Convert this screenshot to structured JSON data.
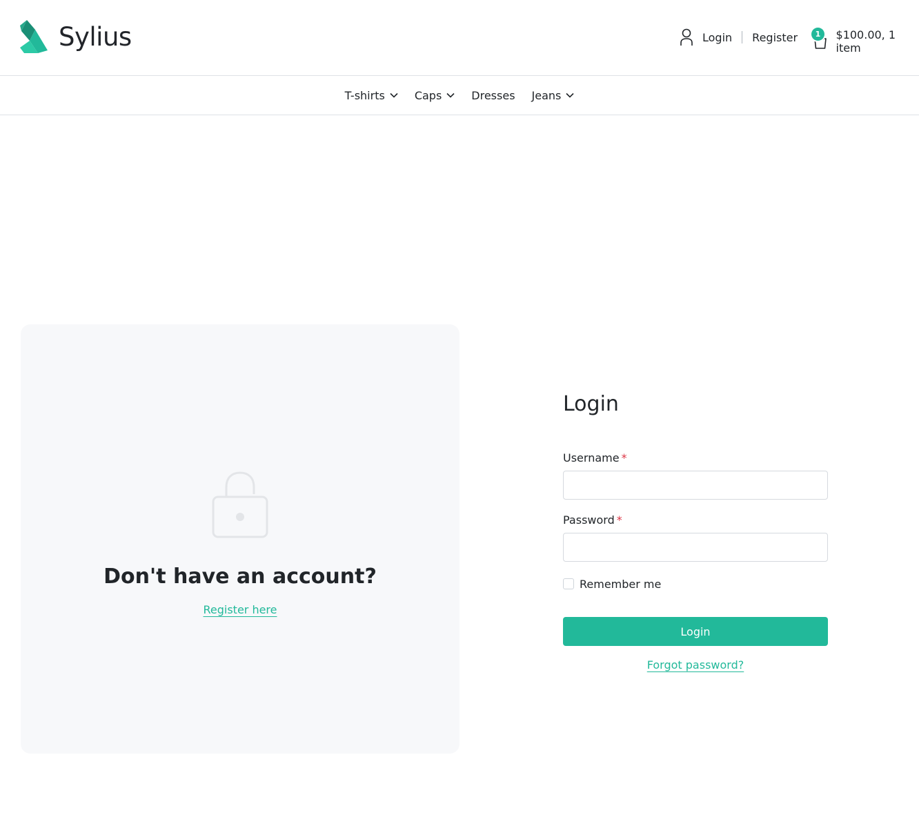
{
  "brand": {
    "name": "Sylius",
    "accent_color": "#22b99a"
  },
  "header": {
    "login_label": "Login",
    "register_label": "Register",
    "cart": {
      "badge_count": "1",
      "total_text": "$100.00, 1 item"
    }
  },
  "nav": {
    "items": [
      {
        "label": "T-shirts",
        "has_dropdown": true
      },
      {
        "label": "Caps",
        "has_dropdown": true
      },
      {
        "label": "Dresses",
        "has_dropdown": false
      },
      {
        "label": "Jeans",
        "has_dropdown": true
      }
    ]
  },
  "register_card": {
    "icon": "lock-icon",
    "title": "Don't have an account?",
    "link_label": "Register here"
  },
  "login_form": {
    "title": "Login",
    "username_label": "Username",
    "username_value": "",
    "password_label": "Password",
    "password_value": "",
    "required_marker": "*",
    "remember_label": "Remember me",
    "remember_checked": false,
    "submit_label": "Login",
    "forgot_label": "Forgot password?"
  }
}
